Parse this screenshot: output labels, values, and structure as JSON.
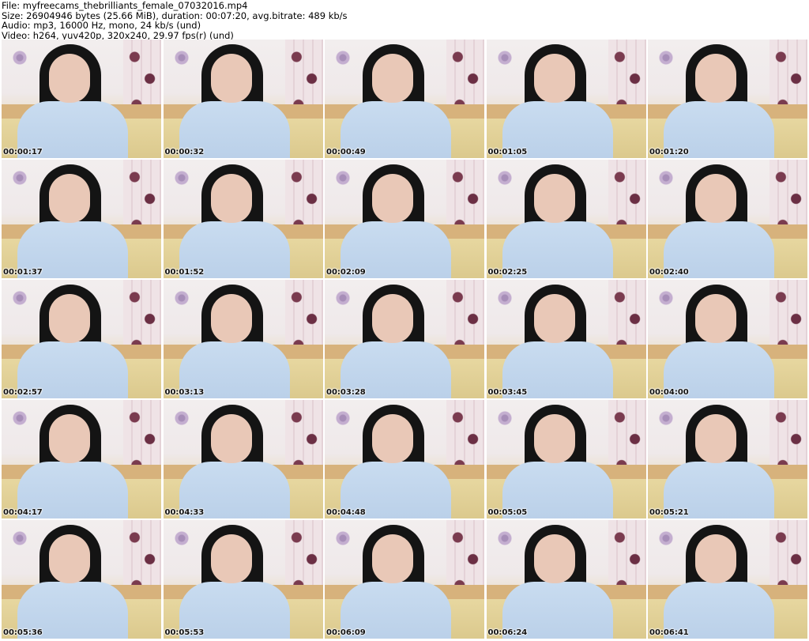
{
  "header": {
    "file_line": "File: myfreecams_thebrilliants_female_07032016.mp4",
    "size_line": "Size: 26904946 bytes (25.66 MiB), duration: 00:07:20, avg.bitrate: 489 kb/s",
    "audio_line": "Audio: mp3, 16000 Hz, mono, 24 kb/s (und)",
    "video_line": "Video: h264, yuv420p, 320x240, 29.97 fps(r) (und)"
  },
  "thumbnails": [
    {
      "timestamp": "00:00:17"
    },
    {
      "timestamp": "00:00:32"
    },
    {
      "timestamp": "00:00:49"
    },
    {
      "timestamp": "00:01:05"
    },
    {
      "timestamp": "00:01:20"
    },
    {
      "timestamp": "00:01:37"
    },
    {
      "timestamp": "00:01:52"
    },
    {
      "timestamp": "00:02:09"
    },
    {
      "timestamp": "00:02:25"
    },
    {
      "timestamp": "00:02:40"
    },
    {
      "timestamp": "00:02:57"
    },
    {
      "timestamp": "00:03:13"
    },
    {
      "timestamp": "00:03:28"
    },
    {
      "timestamp": "00:03:45"
    },
    {
      "timestamp": "00:04:00"
    },
    {
      "timestamp": "00:04:17"
    },
    {
      "timestamp": "00:04:33"
    },
    {
      "timestamp": "00:04:48"
    },
    {
      "timestamp": "00:05:05"
    },
    {
      "timestamp": "00:05:21"
    },
    {
      "timestamp": "00:05:36"
    },
    {
      "timestamp": "00:05:53"
    },
    {
      "timestamp": "00:06:09"
    },
    {
      "timestamp": "00:06:24"
    },
    {
      "timestamp": "00:06:41"
    }
  ]
}
